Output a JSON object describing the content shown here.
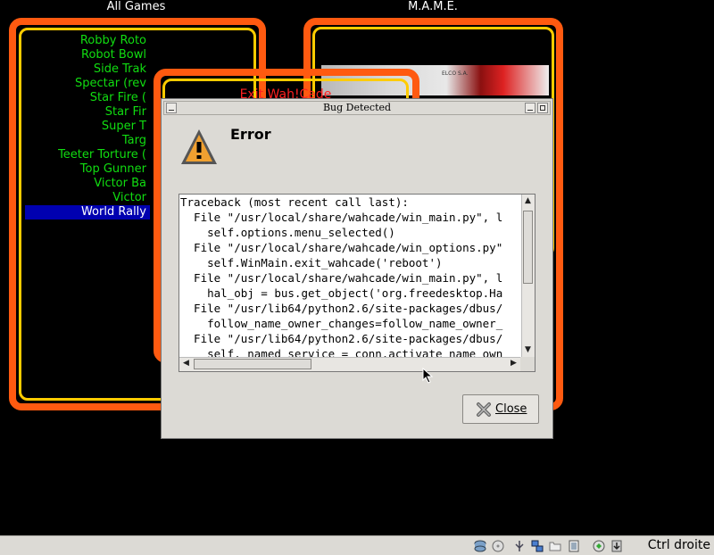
{
  "panels": {
    "left_title": "All Games",
    "right_title": "M.A.M.E."
  },
  "games": [
    "Robby Roto",
    "Robot Bowl",
    "Side Trak",
    "Spectar (rev",
    "Star Fire (",
    "Star Fir",
    "Super T",
    "Targ",
    "Teeter Torture (",
    "Top Gunner",
    "Victor Ba",
    "Victor",
    "World Rally"
  ],
  "selected_game": "World Rally",
  "exit_text": "Exit Wah!Cade",
  "mame_image_text": "ELCO S.A.",
  "dialog": {
    "title": "Bug Detected",
    "heading": "Error",
    "traceback": [
      "Traceback (most recent call last):",
      "  File \"/usr/local/share/wahcade/win_main.py\", l",
      "    self.options.menu_selected()",
      "  File \"/usr/local/share/wahcade/win_options.py\"",
      "    self.WinMain.exit_wahcade('reboot')",
      "  File \"/usr/local/share/wahcade/win_main.py\", l",
      "    hal_obj = bus.get_object('org.freedesktop.Ha",
      "  File \"/usr/lib64/python2.6/site-packages/dbus/",
      "    follow_name_owner_changes=follow_name_owner_",
      "  File \"/usr/lib64/python2.6/site-packages/dbus/",
      "    self._named_service = conn.activate_name_own"
    ],
    "close_label": "Close",
    "close_mnemonic": "C",
    "close_rest": "lose"
  },
  "taskbar": {
    "host_key": "Ctrl droite"
  },
  "colors": {
    "orange": "#ff5a10",
    "yellow": "#ffcc00",
    "green": "#11dd11",
    "selection": "#0000b0",
    "exit_red": "#ff2020"
  }
}
